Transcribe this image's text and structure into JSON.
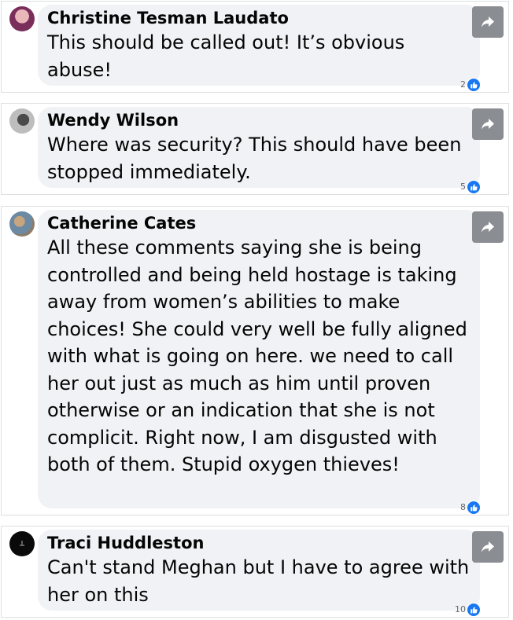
{
  "comments": [
    {
      "author": "Christine Tesman Laudato",
      "text": "This should be called out! It’s obvious abuse!",
      "reaction_count": "2",
      "avatar_icon": "profile-photo-icon",
      "share_icon": "share-arrow-icon",
      "like_icon": "thumbs-up-icon"
    },
    {
      "author": "Wendy Wilson",
      "text": "Where was security? This should have been stopped immediately.",
      "reaction_count": "5",
      "avatar_icon": "profile-photo-icon",
      "share_icon": "share-arrow-icon",
      "like_icon": "thumbs-up-icon"
    },
    {
      "author": "Catherine Cates",
      "text": "All these comments saying she is being controlled and being held hostage is taking away from women’s abilities to make choices! She could very well be fully aligned with what is going on here. we need to call her out just as much as him until proven otherwise or an indication that she is not complicit. Right now, I am disgusted with both of them. Stupid oxygen thieves!",
      "reaction_count": "8",
      "avatar_icon": "profile-photo-icon",
      "share_icon": "share-arrow-icon",
      "like_icon": "thumbs-up-icon"
    },
    {
      "author": "Traci Huddleston",
      "text": "Can't stand Meghan but I have to agree with her on this",
      "reaction_count": "10",
      "avatar_icon": "profile-photo-icon",
      "share_icon": "share-arrow-icon",
      "like_icon": "thumbs-up-icon"
    }
  ],
  "colors": {
    "bubble_bg": "#f0f2f5",
    "like_blue": "#1877f2",
    "share_button_gray": "#8a8d91",
    "border": "#dddfe2"
  }
}
